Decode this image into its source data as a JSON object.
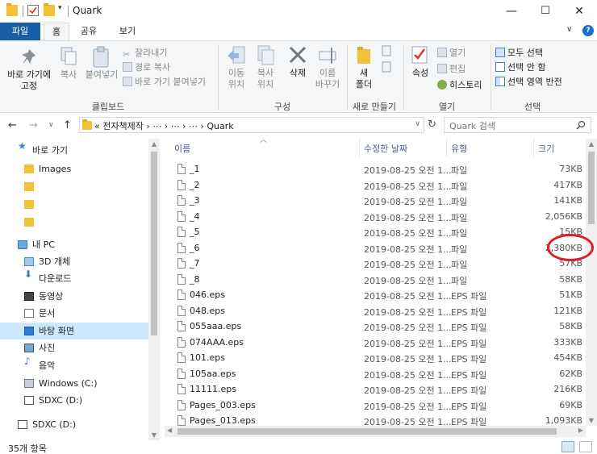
{
  "window": {
    "title": "Quark",
    "controls": {
      "minimize": "—",
      "maximize": "☐",
      "close": "✕"
    }
  },
  "ribbon_tabs": {
    "file": "파일",
    "home": "홈",
    "share": "공유",
    "view": "보기"
  },
  "ribbon": {
    "clipboard": {
      "pin": "바로 가기에\n고정",
      "copy": "복사",
      "paste": "붙여넣기",
      "cut": "잘라내기",
      "copy_path": "경로 복사",
      "paste_shortcut": "바로 가기 붙여넣기",
      "label": "클립보드"
    },
    "organize": {
      "move_to": "이동\n위치",
      "copy_to": "복사\n위치",
      "delete": "삭제",
      "rename": "이름\n바꾸기",
      "label": "구성"
    },
    "new": {
      "new_folder": "새\n폴더",
      "label": "새로 만들기"
    },
    "open": {
      "properties": "속성",
      "open": "열기",
      "edit": "편집",
      "history": "히스토리",
      "label": "열기"
    },
    "select": {
      "select_all": "모두 선택",
      "select_none": "선택 안 함",
      "invert": "선택 영역 반전",
      "label": "선택"
    }
  },
  "address": {
    "path": "« 전자책제작 › ⋯ › ⋯ › ⋯ › Quark",
    "search_placeholder": "Quark 검색"
  },
  "nav_pane": [
    {
      "label": "바로 가기",
      "icon": "star-icon"
    },
    {
      "label": "Images",
      "icon": "folder-icon"
    },
    {
      "label": "",
      "icon": "folder-icon"
    },
    {
      "label": "",
      "icon": "folder-icon"
    },
    {
      "label": "",
      "icon": "folder-icon"
    },
    {
      "label": "내 PC",
      "icon": "pc-icon"
    },
    {
      "label": "3D 개체",
      "icon": "cube-icon"
    },
    {
      "label": "다운로드",
      "icon": "download-icon"
    },
    {
      "label": "동영상",
      "icon": "video-icon"
    },
    {
      "label": "문서",
      "icon": "document-icon"
    },
    {
      "label": "바탕 화면",
      "icon": "desktop-icon"
    },
    {
      "label": "사진",
      "icon": "picture-icon"
    },
    {
      "label": "음악",
      "icon": "music-icon"
    },
    {
      "label": "Windows (C:)",
      "icon": "drive-icon"
    },
    {
      "label": "SDXC (D:)",
      "icon": "sd-icon"
    },
    {
      "label": "SDXC (D:)",
      "icon": "sd-icon"
    }
  ],
  "columns": {
    "name": "이름",
    "date": "수정한 날짜",
    "type": "유형",
    "size": "크기"
  },
  "files": [
    {
      "name": "_1",
      "date": "2019-08-25 오전 1...",
      "type": "파일",
      "size": "73KB"
    },
    {
      "name": "_2",
      "date": "2019-08-25 오전 1...",
      "type": "파일",
      "size": "417KB"
    },
    {
      "name": "_3",
      "date": "2019-08-25 오전 1...",
      "type": "파일",
      "size": "141KB"
    },
    {
      "name": "_4",
      "date": "2019-08-25 오전 1...",
      "type": "파일",
      "size": "2,056KB"
    },
    {
      "name": "_5",
      "date": "2019-08-25 오전 1...",
      "type": "파일",
      "size": "15KB"
    },
    {
      "name": "_6",
      "date": "2019-08-25 오전 1...",
      "type": "파일",
      "size": "2,380KB"
    },
    {
      "name": "_7",
      "date": "2019-08-25 오전 1...",
      "type": "파일",
      "size": "57KB"
    },
    {
      "name": "_8",
      "date": "2019-08-25 오전 1...",
      "type": "파일",
      "size": "58KB"
    },
    {
      "name": "046.eps",
      "date": "2019-08-25 오전 1...",
      "type": "EPS 파일",
      "size": "51KB"
    },
    {
      "name": "048.eps",
      "date": "2019-08-25 오전 1...",
      "type": "EPS 파일",
      "size": "121KB"
    },
    {
      "name": "055aaa.eps",
      "date": "2019-08-25 오전 1...",
      "type": "EPS 파일",
      "size": "58KB"
    },
    {
      "name": "074AAA.eps",
      "date": "2019-08-25 오전 1...",
      "type": "EPS 파일",
      "size": "333KB"
    },
    {
      "name": "101.eps",
      "date": "2019-08-25 오전 1...",
      "type": "EPS 파일",
      "size": "454KB"
    },
    {
      "name": "105aa.eps",
      "date": "2019-08-25 오전 1...",
      "type": "EPS 파일",
      "size": "62KB"
    },
    {
      "name": "11111.eps",
      "date": "2019-08-25 오전 1...",
      "type": "EPS 파일",
      "size": "216KB"
    },
    {
      "name": "Pages_003.eps",
      "date": "2019-08-25 오전 1...",
      "type": "EPS 파일",
      "size": "69KB"
    },
    {
      "name": "Pages_013.eps",
      "date": "2019-08-25 오전 1...",
      "type": "EPS 파일",
      "size": "1,093KB"
    }
  ],
  "status": {
    "count": "35개 항목"
  },
  "colors": {
    "accent": "#1a5ea8",
    "highlight": "#e01e28",
    "selection": "#cce8ff"
  }
}
